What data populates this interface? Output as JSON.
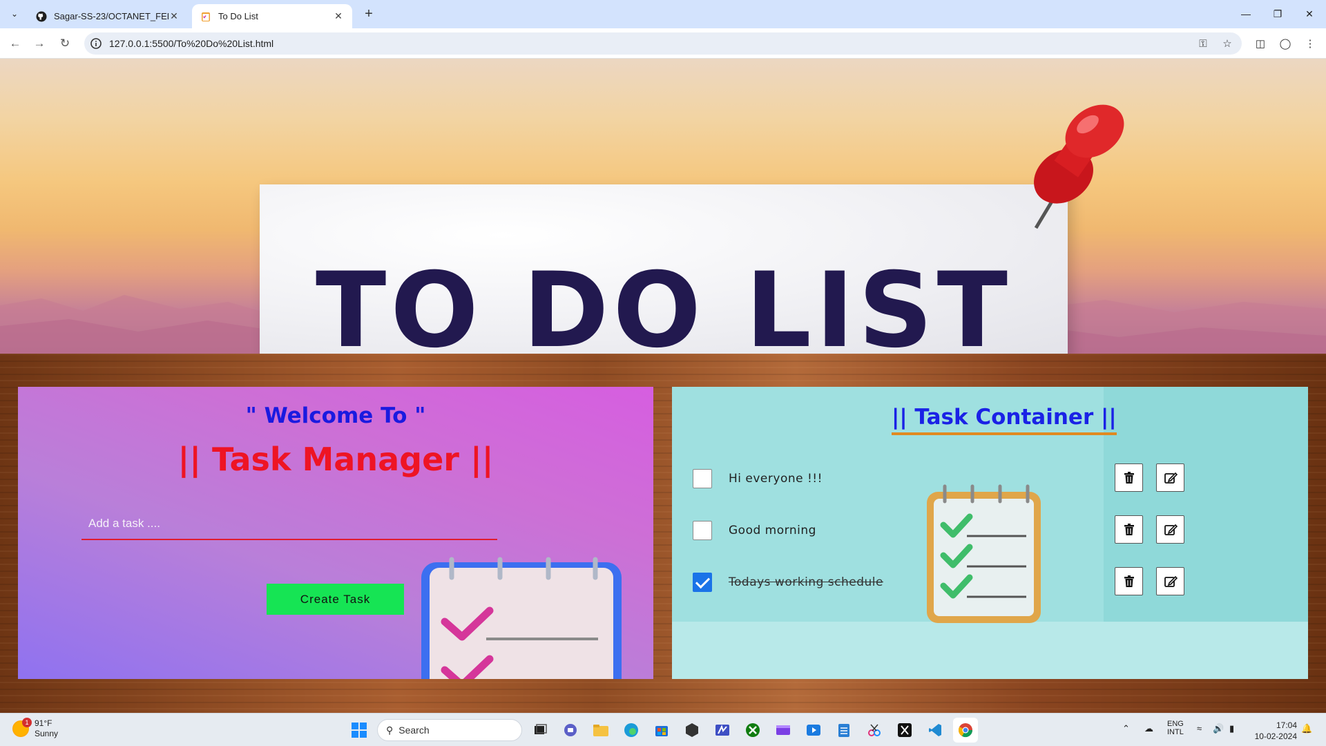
{
  "browser": {
    "tabs": [
      {
        "title": "Sagar-SS-23/OCTANET_FEBRUA",
        "active": false
      },
      {
        "title": "To Do List",
        "active": true
      }
    ],
    "url": "127.0.0.1:5500/To%20Do%20List.html"
  },
  "hero": {
    "title": "TO DO LIST"
  },
  "left_panel": {
    "welcome": "\" Welcome To \"",
    "title": "|| Task Manager ||",
    "input_placeholder": "Add a task ....",
    "create_button": "Create Task"
  },
  "right_panel": {
    "title": "|| Task Container ||",
    "tasks": [
      {
        "text": "Hi everyone !!!",
        "completed": false
      },
      {
        "text": "Good morning",
        "completed": false
      },
      {
        "text": "Todays working schedule",
        "completed": true
      }
    ]
  },
  "taskbar": {
    "weather_temp": "91°F",
    "weather_desc": "Sunny",
    "weather_badge": "1",
    "search_label": "Search",
    "lang_line1": "ENG",
    "lang_line2": "INTL",
    "time": "17:04",
    "date": "10-02-2024"
  },
  "colors": {
    "welcome": "#1a1ae0",
    "task_manager_title": "#ee1424",
    "task_container_title": "#1a22e6",
    "create_button": "#16e454",
    "input_underline": "#e01b2e",
    "hero_title": "#22194f"
  }
}
